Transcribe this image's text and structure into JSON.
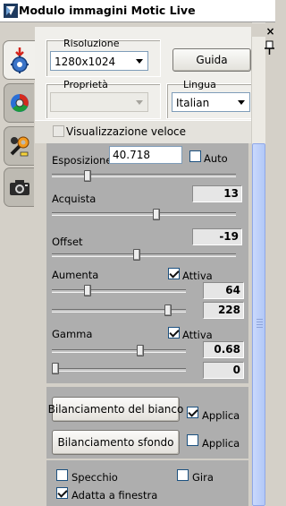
{
  "window": {
    "title": "Modulo immagini Motic Live"
  },
  "tabs": [
    {
      "name": "camera-settings",
      "icon": "camera-gear-icon",
      "active": true
    },
    {
      "name": "color",
      "icon": "color-wheel-icon",
      "active": false
    },
    {
      "name": "tools",
      "icon": "wrench-tools-icon",
      "active": false
    },
    {
      "name": "capture",
      "icon": "camera-icon",
      "active": false
    }
  ],
  "resolution": {
    "label": "Risoluzione",
    "value": "1280x1024"
  },
  "guide_button": {
    "label": "Guida"
  },
  "properties": {
    "label": "Proprietà",
    "value": ""
  },
  "language": {
    "label": "Lingua",
    "value": "Italian"
  },
  "fast_view": {
    "label": "Visualizzazione veloce",
    "checked": false
  },
  "exposure": {
    "label": "Esposizione",
    "value": "40.718",
    "auto_label": "Auto",
    "auto_checked": false,
    "slider_fraction": 0.18
  },
  "acquire": {
    "label": "Acquista",
    "value": "13",
    "slider_fraction": 0.57
  },
  "offset": {
    "label": "Offset",
    "value": "-19",
    "slider_fraction": 0.46
  },
  "gain": {
    "label": "Aumenta",
    "active_label": "Attiva",
    "active_checked": true,
    "value1": "64",
    "value2": "228",
    "slider1_fraction": 0.25,
    "slider2_fraction": 0.89
  },
  "gamma": {
    "label": "Gamma",
    "active_label": "Attiva",
    "active_checked": true,
    "value1": "0.68",
    "value2": "0",
    "slider1_fraction": 0.67,
    "slider2_fraction": 0.0
  },
  "white_balance": {
    "button_label": "Bilanciamento del bianco",
    "apply_label": "Applica",
    "apply_checked": true
  },
  "background_balance": {
    "button_label": "Bilanciamento sfondo",
    "apply_label": "Applica",
    "apply_checked": false
  },
  "mirror": {
    "label": "Specchio",
    "checked": false
  },
  "rotate": {
    "label": "Gira",
    "checked": false
  },
  "fit_window": {
    "label": "Adatta a finestra",
    "checked": true
  },
  "colors": {
    "panel_gray": "#aeaeae",
    "scroll_blue": "#b2c8f7",
    "title_bg": "#ffffff"
  }
}
